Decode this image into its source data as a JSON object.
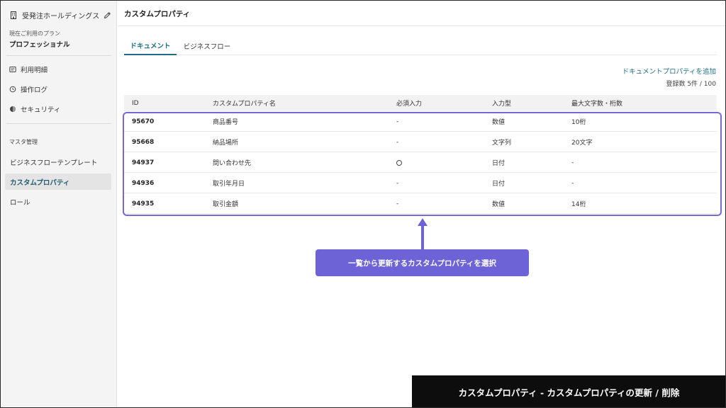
{
  "sidebar": {
    "org_name": "受発注ホールディングス",
    "org_icon": "building-icon",
    "edit_icon": "pencil-icon",
    "plan_label": "現在ご利用のプラン",
    "plan_value": "プロフェッショナル",
    "nav": [
      {
        "label": "利用明細",
        "icon": "receipt-icon"
      },
      {
        "label": "操作ログ",
        "icon": "history-icon"
      },
      {
        "label": "セキュリティ",
        "icon": "shield-icon"
      }
    ],
    "master_label": "マスタ管理",
    "master_items": [
      {
        "label": "ビジネスフローテンプレート",
        "active": false
      },
      {
        "label": "カスタムプロパティ",
        "active": true
      },
      {
        "label": "ロール",
        "active": false
      }
    ]
  },
  "header": {
    "title": "カスタムプロパティ"
  },
  "tabs": [
    {
      "label": "ドキュメント",
      "active": true
    },
    {
      "label": "ビジネスフロー",
      "active": false
    }
  ],
  "actions": {
    "add_link": "ドキュメントプロパティを追加",
    "count": "登録数 5件 / 100"
  },
  "table": {
    "columns": [
      "ID",
      "カスタムプロパティ名",
      "必須入力",
      "入力型",
      "最大文字数・桁数"
    ],
    "rows": [
      {
        "id": "95670",
        "name": "商品番号",
        "required": "-",
        "type": "数値",
        "max": "10桁"
      },
      {
        "id": "95668",
        "name": "納品場所",
        "required": "-",
        "type": "文字列",
        "max": "20文字"
      },
      {
        "id": "94937",
        "name": "問い合わせ先",
        "required": "○",
        "type": "日付",
        "max": "-"
      },
      {
        "id": "94936",
        "name": "取引年月日",
        "required": "-",
        "type": "日付",
        "max": "-"
      },
      {
        "id": "94935",
        "name": "取引金額",
        "required": "-",
        "type": "数値",
        "max": "14桁"
      }
    ]
  },
  "annotation": {
    "callout": "一覧から更新するカスタムプロパティを選択",
    "caption": "カスタムプロパティ - カスタムプロパティの更新 / 削除",
    "accent_color": "#6d63d6",
    "brand_color": "#1f6d85"
  }
}
